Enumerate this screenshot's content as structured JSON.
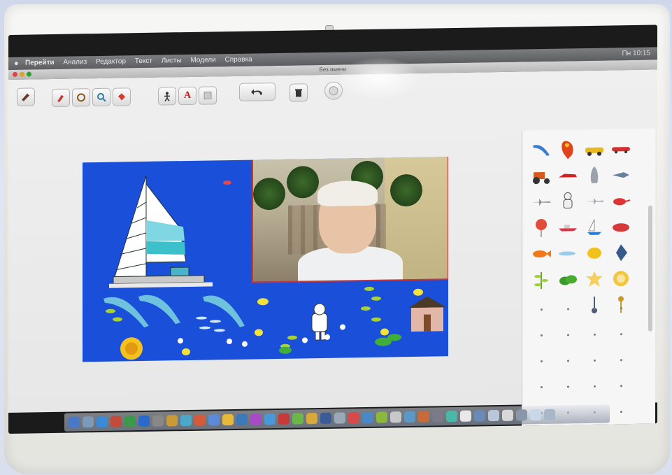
{
  "menubar": {
    "apple": "",
    "app_name": "Перейти",
    "menus": [
      "Анализ",
      "Редактор",
      "Текст",
      "Листы",
      "Модели",
      "Справка"
    ],
    "status": "Пн 10:15"
  },
  "window": {
    "title": "Без имени"
  },
  "toolbar": {
    "tools": [
      {
        "name": "pointer-tool",
        "icon": "pointer-icon"
      },
      {
        "name": "brush-tool",
        "icon": "brush-icon"
      },
      {
        "name": "rotate-tool",
        "icon": "rotate-icon"
      },
      {
        "name": "zoom-tool",
        "icon": "zoom-icon"
      },
      {
        "name": "paint-tool",
        "icon": "paint-bucket-icon"
      },
      {
        "name": "figure-tool",
        "icon": "figure-icon"
      },
      {
        "name": "text-tool",
        "label": "A",
        "icon": "text-icon"
      },
      {
        "name": "background-tool",
        "icon": "background-icon"
      },
      {
        "name": "undo-button",
        "icon": "undo-icon"
      },
      {
        "name": "clear-button",
        "icon": "trash-icon"
      },
      {
        "name": "record-button",
        "icon": "record-icon"
      }
    ]
  },
  "palette": {
    "items": [
      "dolphin-icon",
      "parrot-icon",
      "car-yellow-icon",
      "car-red-icon",
      "tractor-icon",
      "racecar-icon",
      "rocket-icon",
      "jet-icon",
      "plane-icon",
      "astronaut-icon",
      "airplane-icon",
      "helicopter-icon",
      "balloon-icon",
      "ship-icon",
      "boat-icon",
      "submarine-icon",
      "fish-orange-icon",
      "fish-stripe-icon",
      "fish-yellow-icon",
      "fish-angel-icon",
      "plant-icon",
      "bush-icon",
      "star-flower-icon",
      "sun-flower-icon",
      "blank",
      "blank",
      "key-blue-icon",
      "key-gold-icon"
    ]
  },
  "stage": {
    "background_color": "#1a4fd9",
    "webcam_border": "#cc3333"
  },
  "dock": {
    "count": 38
  }
}
